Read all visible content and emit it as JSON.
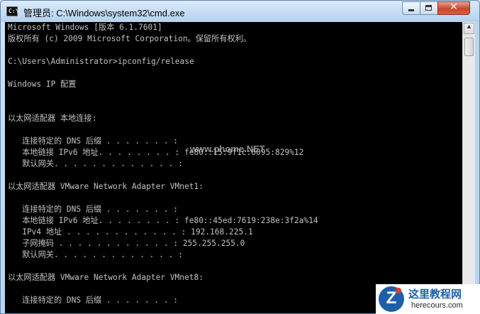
{
  "window": {
    "title": "管理员: C:\\Windows\\system32\\cmd.exe",
    "app_icon": "cmd-icon",
    "app_icon_text": "C:\\"
  },
  "controls": {
    "minimize": "minimize-icon",
    "maximize": "maximize-icon",
    "close_label": "✕"
  },
  "console": {
    "lines": [
      "Microsoft Windows [版本 6.1.7601]",
      "版权所有 (c) 2009 Microsoft Corporation。保留所有权利。",
      "",
      "C:\\Users\\Administrator>ipconfig/release",
      "",
      "Windows IP 配置",
      "",
      "",
      "以太网适配器 本地连接:",
      "",
      "   连接特定的 DNS 后缀 . . . . . . . :",
      "   本地链接 IPv6 地址. . . . . . . . : fe80::15:9f1c:6095:829%12",
      "   默认网关. . . . . . . . . . . . . :",
      "",
      "以太网适配器 VMware Network Adapter VMnet1:",
      "",
      "   连接特定的 DNS 后缀 . . . . . . . :",
      "   本地链接 IPv6 地址. . . . . . . . : fe80::45ed:7619:238e:3f2a%14",
      "   IPv4 地址 . . . . . . . . . . . . : 192.168.225.1",
      "   子网掩码 . . . . . . . . . . . . : 255.255.255.0",
      "   默认网关. . . . . . . . . . . . . :",
      "",
      "以太网适配器 VMware Network Adapter VMnet8:",
      "",
      "   连接特定的 DNS 后缀 . . . . . . . :"
    ]
  },
  "scrollbar": {
    "up_arrow": "▲"
  },
  "watermarks": {
    "overlay": "www.phome.NET",
    "site_title": "这里教程网",
    "site_url": "herecours.com",
    "logo_letter": "Z"
  }
}
